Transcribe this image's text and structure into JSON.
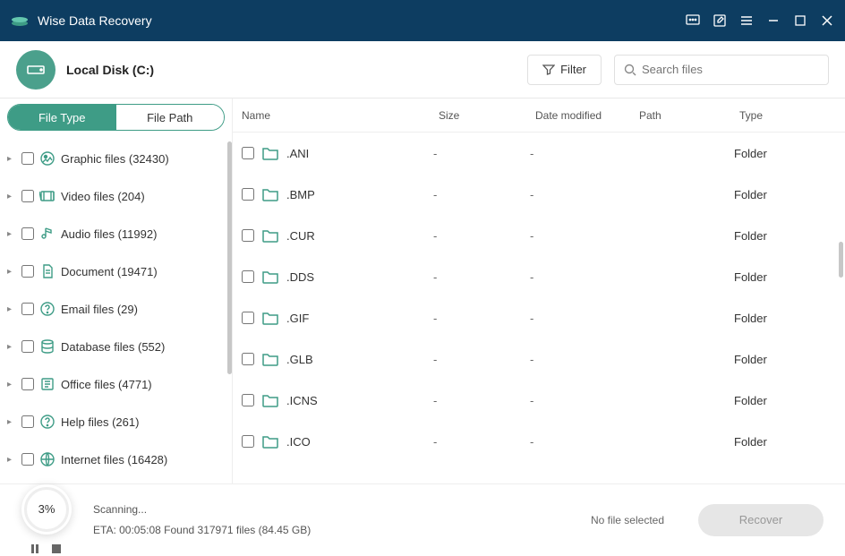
{
  "app": {
    "title": "Wise Data Recovery"
  },
  "drive": {
    "label": "Local Disk (C:)"
  },
  "filter": {
    "label": "Filter"
  },
  "search": {
    "placeholder": "Search files"
  },
  "toggle": {
    "file_type": "File Type",
    "file_path": "File Path"
  },
  "categories": [
    {
      "label": "Graphic files (32430)",
      "icon": "image"
    },
    {
      "label": "Video files (204)",
      "icon": "video"
    },
    {
      "label": "Audio files (11992)",
      "icon": "audio"
    },
    {
      "label": "Document (19471)",
      "icon": "document"
    },
    {
      "label": "Email files (29)",
      "icon": "help"
    },
    {
      "label": "Database files (552)",
      "icon": "database"
    },
    {
      "label": "Office files (4771)",
      "icon": "office"
    },
    {
      "label": "Help files (261)",
      "icon": "help"
    },
    {
      "label": "Internet files (16428)",
      "icon": "internet"
    }
  ],
  "columns": {
    "name": "Name",
    "size": "Size",
    "date": "Date modified",
    "path": "Path",
    "type": "Type"
  },
  "rows": [
    {
      "name": ".ANI",
      "size": "-",
      "date": "-",
      "path": "",
      "type": "Folder"
    },
    {
      "name": ".BMP",
      "size": "-",
      "date": "-",
      "path": "",
      "type": "Folder"
    },
    {
      "name": ".CUR",
      "size": "-",
      "date": "-",
      "path": "",
      "type": "Folder"
    },
    {
      "name": ".DDS",
      "size": "-",
      "date": "-",
      "path": "",
      "type": "Folder"
    },
    {
      "name": ".GIF",
      "size": "-",
      "date": "-",
      "path": "",
      "type": "Folder"
    },
    {
      "name": ".GLB",
      "size": "-",
      "date": "-",
      "path": "",
      "type": "Folder"
    },
    {
      "name": ".ICNS",
      "size": "-",
      "date": "-",
      "path": "",
      "type": "Folder"
    },
    {
      "name": ".ICO",
      "size": "-",
      "date": "-",
      "path": "",
      "type": "Folder"
    }
  ],
  "status": {
    "progress_pct": "3%",
    "scanning": "Scanning...",
    "eta": "ETA: 00:05:08 Found 317971 files (84.45 GB)",
    "no_file": "No file selected",
    "recover": "Recover"
  }
}
